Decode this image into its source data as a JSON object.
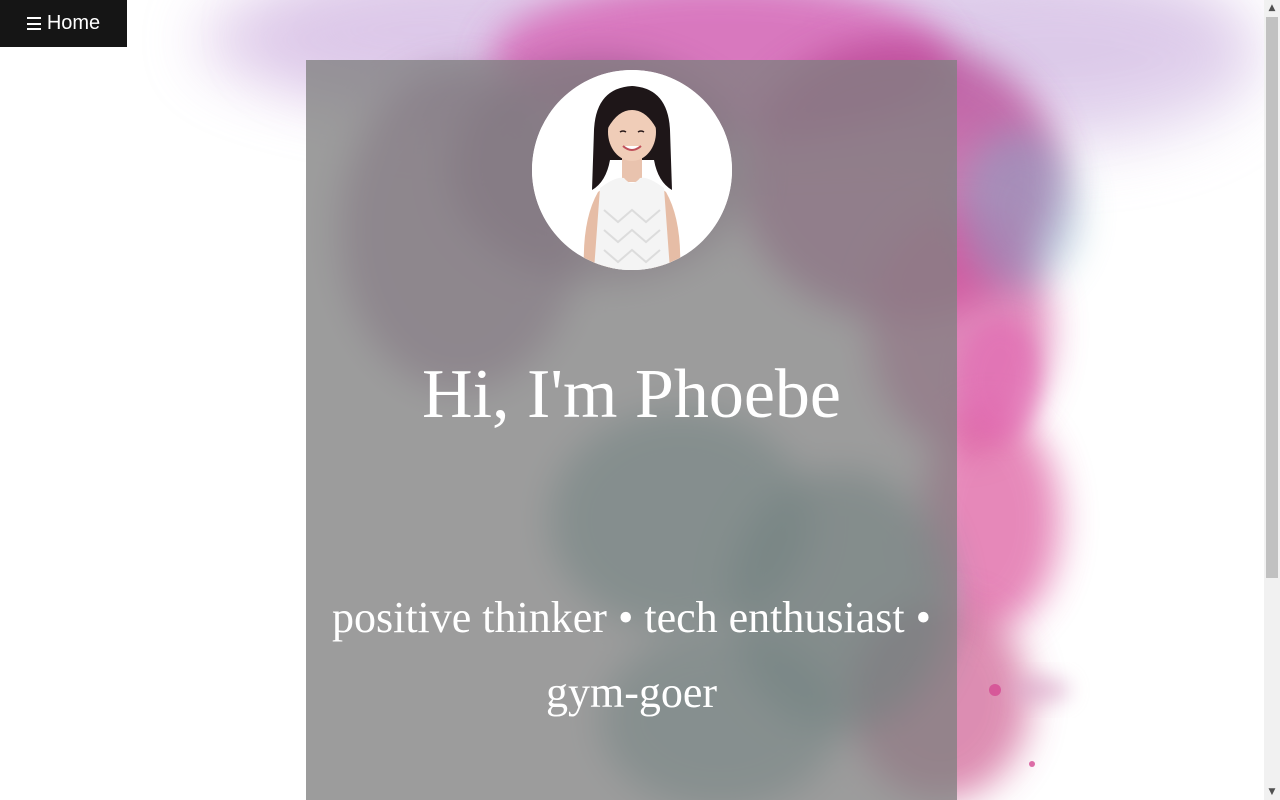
{
  "nav": {
    "menu_label": "Home",
    "menu_icon": "hamburger-icon"
  },
  "hero": {
    "avatar_alt": "profile-photo",
    "headline": "Hi, I'm Phoebe",
    "tagline": "positive thinker • tech enthusiast • gym-goer"
  },
  "colors": {
    "menu_background": "#151515",
    "card_overlay": "#808080",
    "text": "#ffffff",
    "ink_pink": "#d43a8a",
    "ink_teal": "#3e8a86",
    "ink_purple": "#8a5aa8"
  }
}
